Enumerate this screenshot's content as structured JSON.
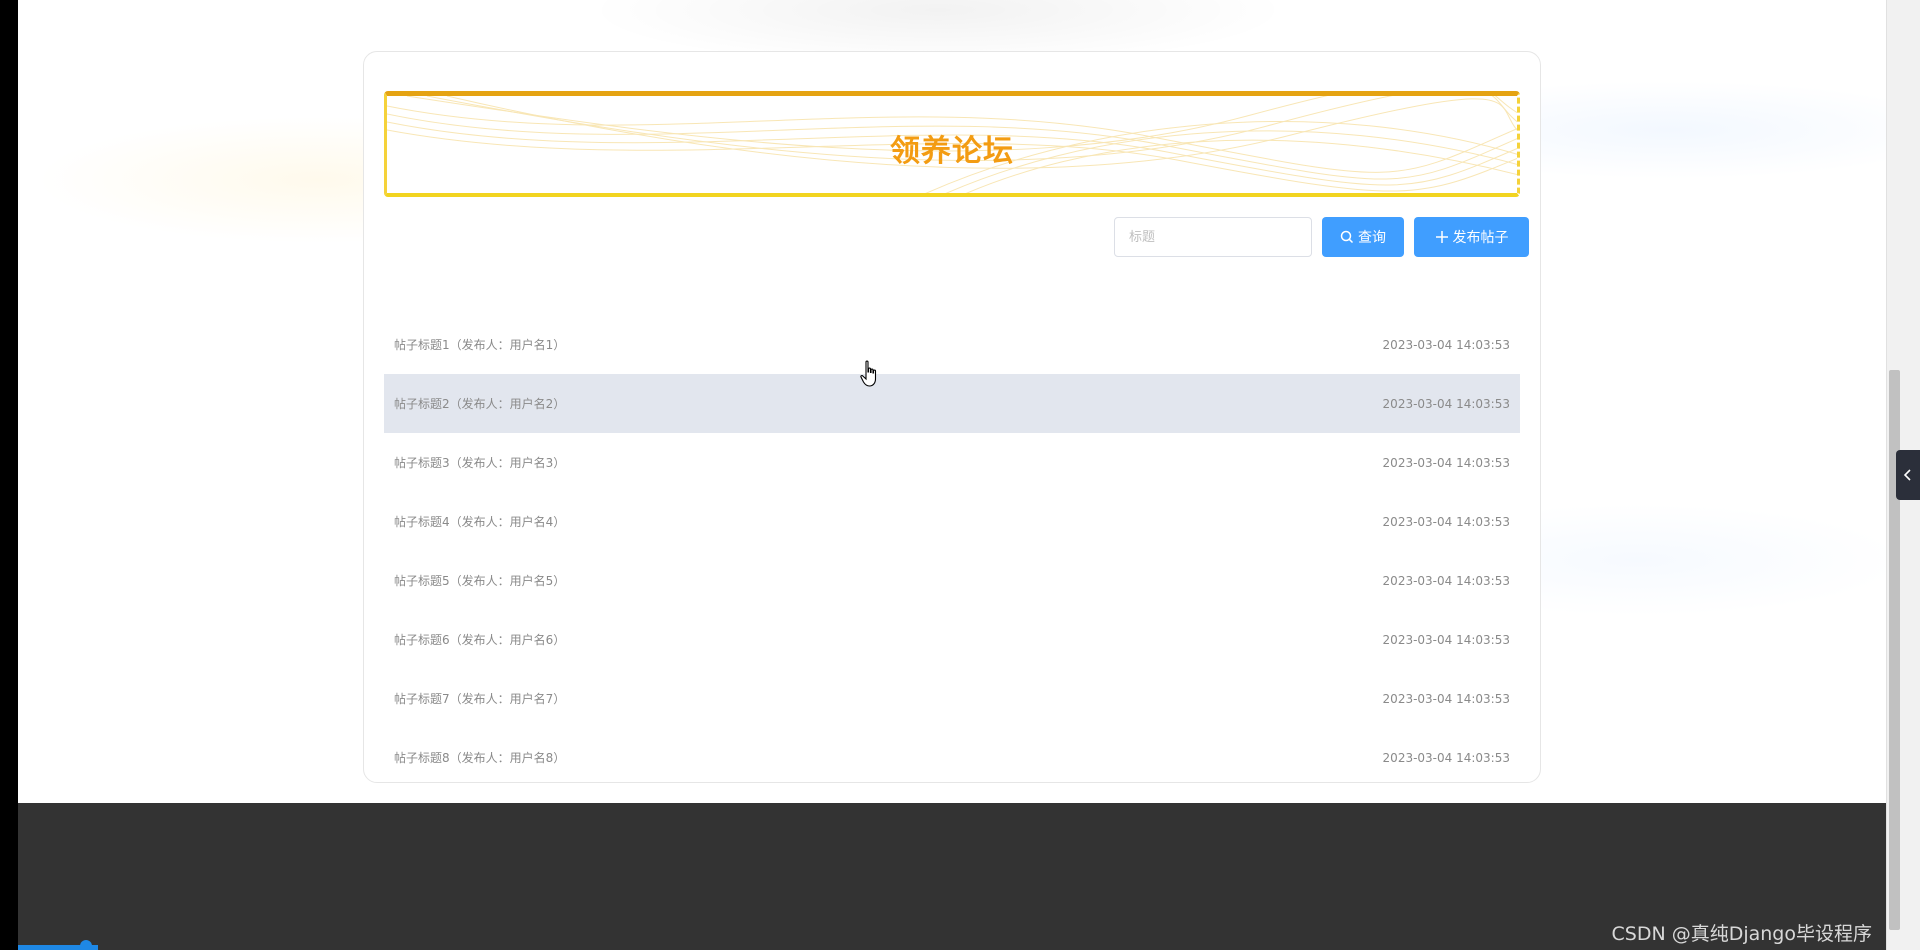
{
  "banner": {
    "title": "领养论坛"
  },
  "search": {
    "placeholder": "标题",
    "value": ""
  },
  "buttons": {
    "query_label": "查询",
    "publish_label": "发布帖子"
  },
  "posts": [
    {
      "title": "帖子标题1（发布人：用户名1）",
      "time": "2023-03-04 14:03:53"
    },
    {
      "title": "帖子标题2（发布人：用户名2）",
      "time": "2023-03-04 14:03:53"
    },
    {
      "title": "帖子标题3（发布人：用户名3）",
      "time": "2023-03-04 14:03:53"
    },
    {
      "title": "帖子标题4（发布人：用户名4）",
      "time": "2023-03-04 14:03:53"
    },
    {
      "title": "帖子标题5（发布人：用户名5）",
      "time": "2023-03-04 14:03:53"
    },
    {
      "title": "帖子标题6（发布人：用户名6）",
      "time": "2023-03-04 14:03:53"
    },
    {
      "title": "帖子标题7（发布人：用户名7）",
      "time": "2023-03-04 14:03:53"
    },
    {
      "title": "帖子标题8（发布人：用户名8）",
      "time": "2023-03-04 14:03:53"
    }
  ],
  "watermark": "CSDN @真纯Django毕设程序",
  "colors": {
    "accent": "#409eff",
    "banner_title": "#f39c12",
    "footer": "#333333",
    "row_hover": "#e2e6ee"
  },
  "icons": {
    "query": "search-icon",
    "publish": "plus-icon",
    "side_toggle": "chevron-left-icon",
    "cursor": "hand-pointer-icon"
  }
}
